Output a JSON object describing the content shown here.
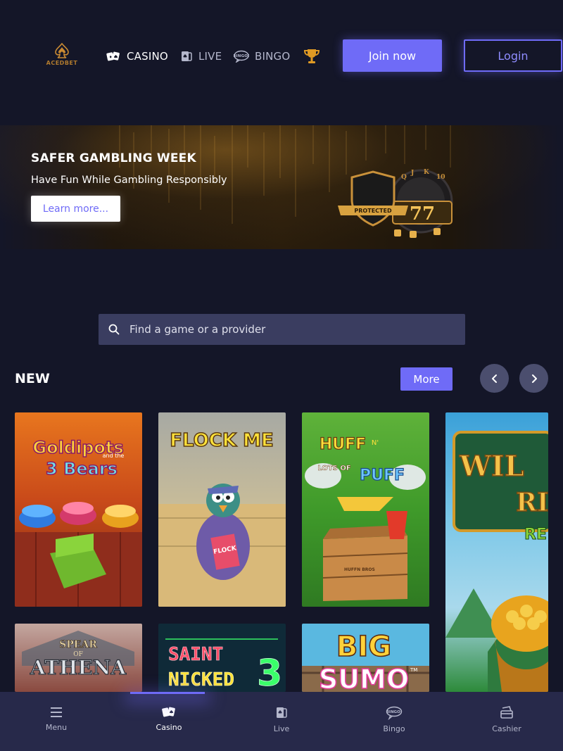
{
  "header": {
    "logo_text": "ACEDBET",
    "nav": [
      {
        "label": "CASINO",
        "icon": "cards-icon"
      },
      {
        "label": "LIVE",
        "icon": "live-cards-icon"
      },
      {
        "label": "BINGO",
        "icon": "bingo-icon"
      }
    ],
    "trophy_icon": "trophy-icon",
    "join_label": "Join now",
    "login_label": "Login"
  },
  "banner": {
    "title": "SAFER GAMBLING WEEK",
    "subtitle": "Have Fun While Gambling Responsibly",
    "cta_label": "Learn more...",
    "shield_text": "PROTECTED",
    "reel_text": "77"
  },
  "search": {
    "placeholder": "Find a game or a provider",
    "icon": "search-icon"
  },
  "section": {
    "title": "NEW",
    "more_label": "More"
  },
  "games": [
    {
      "title_line1": "Goldipots",
      "title_small": "and the",
      "title_line2": "3 Bears"
    },
    {
      "title_line1": "FLOCK ME",
      "shirt_text": "FLOCK"
    },
    {
      "title_line1": "HUFF",
      "title_small": "N'",
      "title_line2": "LOTS OF",
      "title_line3": "PUFF",
      "crate_text": "HUFFN BROS"
    },
    {
      "title_line1": "WIL",
      "title_line2": "RI",
      "title_line3": "RE"
    },
    {
      "title_line1": "SPEAR",
      "title_small": "OF",
      "title_line2": "ATHENA"
    },
    {
      "title_line1": "SAINT",
      "title_line2": "NICKED",
      "title_number": "3"
    },
    {
      "title_line1": "BIG",
      "title_line2": "SUMO",
      "trademark": "TM"
    }
  ],
  "bottom_nav": [
    {
      "label": "Menu",
      "icon": "menu-icon"
    },
    {
      "label": "Casino",
      "icon": "cards-icon"
    },
    {
      "label": "Live",
      "icon": "live-cards-icon"
    },
    {
      "label": "Bingo",
      "icon": "bingo-icon"
    },
    {
      "label": "Cashier",
      "icon": "cashier-icon"
    }
  ],
  "colors": {
    "background": "#141628",
    "accent": "#6f6bf7",
    "search_bg": "#3a3d60",
    "bottom_nav_bg": "#27294a"
  }
}
